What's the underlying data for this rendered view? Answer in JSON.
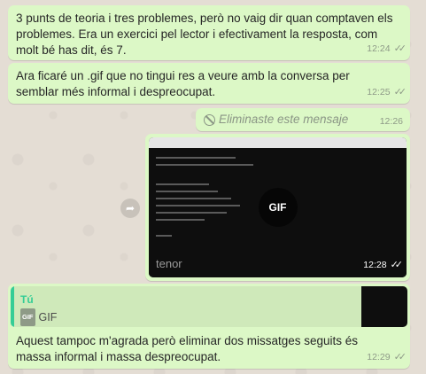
{
  "messages": [
    {
      "text": "3 punts de teoria i tres problemes, però no vaig dir quan comptaven  els problemes. Era un exercici pel lector i efectivament la resposta, com molt bé has dit, és 7.",
      "time": "12:24",
      "status": "read"
    },
    {
      "text": "Ara ficaré un .gif que no tingui res a veure amb la conversa per semblar més informal i despreocupat.",
      "time": "12:25",
      "status": "read"
    },
    {
      "text": "Eliminaste este mensaje",
      "time": "12:26",
      "icon": "ban-icon"
    },
    {
      "gif_badge": "GIF",
      "watermark": "tenor",
      "time": "12:28",
      "status": "read"
    },
    {
      "reply": {
        "author": "Tú",
        "badge": "GIF",
        "label": "GIF"
      },
      "text": "Aquest tampoc m'agrada però eliminar dos missatges seguits és massa informal i massa despreocupat.",
      "time": "12:29",
      "status": "read"
    }
  ],
  "colors": {
    "outgoing_bubble": "#dcf8c6",
    "wallpaper": "#e4ddd4",
    "quote_accent": "#35cd96"
  }
}
